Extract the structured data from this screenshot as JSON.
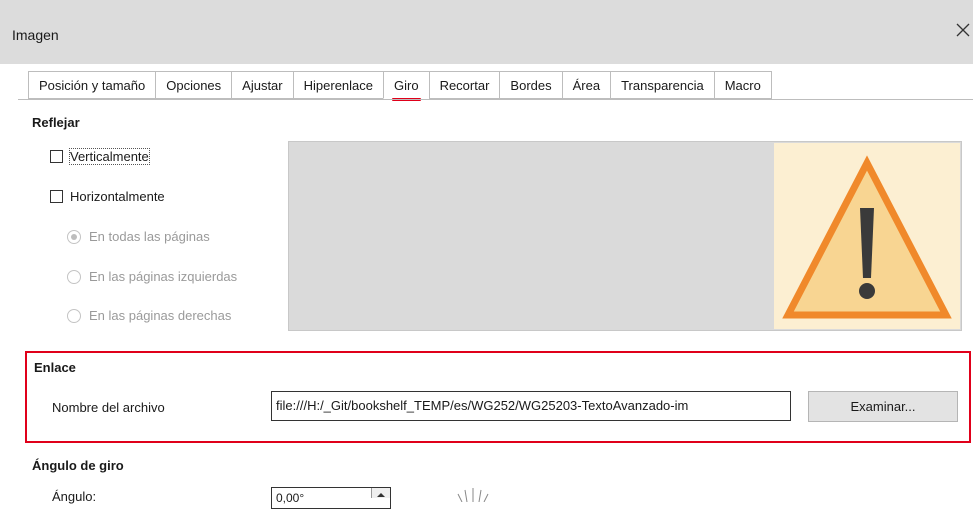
{
  "window": {
    "title": "Imagen",
    "close_icon": "close-icon"
  },
  "tabs": [
    {
      "label": "Posición y tamaño"
    },
    {
      "label": "Opciones"
    },
    {
      "label": "Ajustar"
    },
    {
      "label": "Hiperenlace"
    },
    {
      "label": "Giro",
      "active": true
    },
    {
      "label": "Recortar"
    },
    {
      "label": "Bordes"
    },
    {
      "label": "Área"
    },
    {
      "label": "Transparencia"
    },
    {
      "label": "Macro"
    }
  ],
  "reflejar": {
    "heading": "Reflejar",
    "vertical_label": "Verticalmente",
    "horizontal_label": "Horizontalmente",
    "radio_all_pages": "En todas las páginas",
    "radio_left_pages": "En las páginas izquierdas",
    "radio_right_pages": "En las páginas derechas"
  },
  "enlace": {
    "heading": "Enlace",
    "file_name_label": "Nombre del archivo",
    "file_name_value": "file:///H:/_Git/bookshelf_TEMP/es/WG252/WG25203-TextoAvanzado-im",
    "browse_label": "Examinar..."
  },
  "angulo": {
    "heading": "Ángulo de giro",
    "angle_label": "Ángulo:",
    "angle_value": "0,00°"
  },
  "colors": {
    "active_tab_underline": "#e0001a",
    "highlight_box": "#e0001a",
    "warning_fill": "#f8d592",
    "warning_stroke": "#f0892b",
    "warning_mark": "#3a3a3a"
  }
}
